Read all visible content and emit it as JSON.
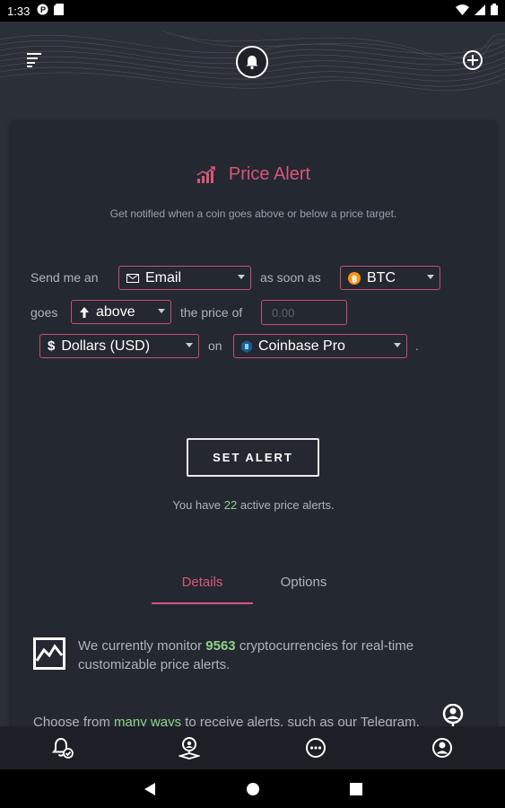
{
  "status_bar": {
    "time": "1:33"
  },
  "card": {
    "title": "Price Alert",
    "subtitle": "Get notified when a coin goes above or below a price target."
  },
  "form": {
    "send_me_an": "Send me an",
    "method": "Email",
    "as_soon_as": "as soon as",
    "coin": "BTC",
    "goes": "goes",
    "direction": "above",
    "the_price_of": "the price of",
    "price_placeholder": "0.00",
    "currency": "Dollars (USD)",
    "on": "on",
    "exchange": "Coinbase Pro",
    "period": "."
  },
  "actions": {
    "set_alert": "SET ALERT"
  },
  "active_alerts": {
    "prefix": "You have",
    "count": "22",
    "suffix": "active price alerts."
  },
  "tabs": [
    {
      "label": "Details",
      "active": true
    },
    {
      "label": "Options",
      "active": false
    }
  ],
  "details": {
    "monitor_prefix": "We currently monitor",
    "monitor_count": "9563",
    "monitor_suffix": "cryptocurrencies for real-time customizable price alerts.",
    "ways_prefix": "Choose from",
    "ways_link": "many ways",
    "ways_suffix": "to receive alerts, such as our Telegram, Discord or Slack bots"
  },
  "colors": {
    "accent": "#d8567a",
    "highlight": "#8fd18b",
    "background": "#2b2f37",
    "card": "#242830",
    "btc": "#f7931a"
  },
  "icons": {
    "header": [
      "menu-icon",
      "bell-icon",
      "add-circle-icon"
    ],
    "bottom_nav": [
      "alerts-icon",
      "location-icon",
      "more-icon",
      "profile-icon"
    ],
    "system_nav": [
      "back-icon",
      "home-icon",
      "recents-icon"
    ]
  }
}
